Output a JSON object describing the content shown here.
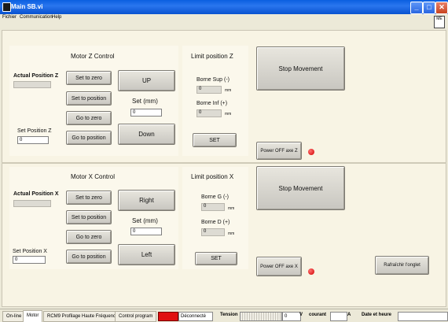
{
  "window": {
    "title": "Main SB.vi",
    "minimize": "_",
    "maximize": "□",
    "close": "✕"
  },
  "menu": [
    "Fichier",
    "Communication",
    "Help"
  ],
  "vi_icon_text": "ME",
  "motor_z": {
    "title": "Motor Z Control",
    "actual_label": "Actual Position Z",
    "actual_value": "",
    "set_to_zero": "Set to zero",
    "set_to_position": "Set to position",
    "go_to_zero": "Go to zero",
    "go_to_position": "Go to position",
    "up": "UP",
    "down": "Down",
    "set_mm_label": "Set (mm)",
    "set_mm_value": "0",
    "set_position_label": "Set Position Z",
    "set_position_value": "0"
  },
  "limit_z": {
    "title": "Limit position Z",
    "sup_label": "Borne Sup (-)",
    "sup_value": "0",
    "sup_unit": "mm",
    "inf_label": "Borne Inf (+)",
    "inf_value": "0",
    "inf_unit": "mm",
    "set": "SET"
  },
  "stop_z": "Stop Movement",
  "power_z": "Power OFF axe Z",
  "motor_x": {
    "title": "Motor X Control",
    "actual_label": "Actual Position X",
    "actual_value": "",
    "set_to_zero": "Set to zero",
    "set_to_position": "Set to position",
    "go_to_zero": "Go to zero",
    "go_to_position": "Go to position",
    "right": "Right",
    "left": "Left",
    "set_mm_label": "Set (mm)",
    "set_mm_value": "0",
    "set_position_label": "Set Position X",
    "set_position_value": "0"
  },
  "limit_x": {
    "title": "Limit position X",
    "g_label": "Borne G (-)",
    "g_value": "0",
    "g_unit": "mm",
    "d_label": "Borne D (+)",
    "d_value": "0",
    "d_unit": "mm",
    "set": "SET"
  },
  "stop_x": "Stop Movement",
  "power_x": "Power OFF axe X",
  "refresh": "Rafraîchir l'onglet",
  "tabs": [
    "On-line",
    "Motor",
    "RCM9 Profilage Haute Fréquence",
    "Control program"
  ],
  "status": {
    "connection": "Déconnecté",
    "tension_label": "Tension",
    "tension_value": "0",
    "tension_unit": "V",
    "courant_label": "courant",
    "courant_value": "",
    "courant_unit": "A",
    "datetime_label": "Date et heure",
    "datetime_value": "",
    "led_color": "#E01010"
  }
}
